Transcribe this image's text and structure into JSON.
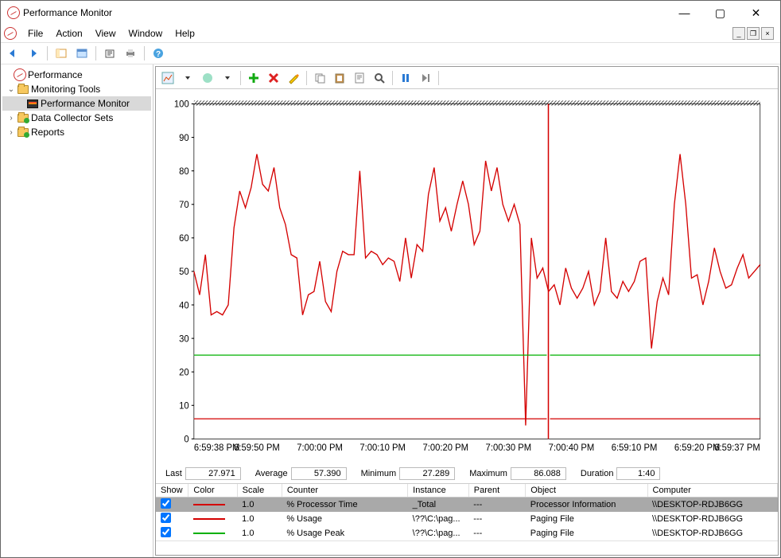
{
  "title": "Performance Monitor",
  "menus": [
    "File",
    "Action",
    "View",
    "Window",
    "Help"
  ],
  "tree": {
    "root": "Performance",
    "monitoring": "Monitoring Tools",
    "perfmon": "Performance Monitor",
    "dcs": "Data Collector Sets",
    "reports": "Reports"
  },
  "stats": {
    "last_label": "Last",
    "last": "27.971",
    "avg_label": "Average",
    "avg": "57.390",
    "min_label": "Minimum",
    "min": "27.289",
    "max_label": "Maximum",
    "max": "86.088",
    "dur_label": "Duration",
    "dur": "1:40"
  },
  "table": {
    "headers": [
      "Show",
      "Color",
      "Scale",
      "Counter",
      "Instance",
      "Parent",
      "Object",
      "Computer"
    ],
    "rows": [
      {
        "checked": true,
        "color": "#d40000",
        "scale": "1.0",
        "counter": "% Processor Time",
        "instance": "_Total",
        "parent": "---",
        "object": "Processor Information",
        "computer": "\\\\DESKTOP-RDJB6GG",
        "sel": true
      },
      {
        "checked": true,
        "color": "#d40000",
        "scale": "1.0",
        "counter": "% Usage",
        "instance": "\\??\\C:\\pag...",
        "parent": "---",
        "object": "Paging File",
        "computer": "\\\\DESKTOP-RDJB6GG"
      },
      {
        "checked": true,
        "color": "#00b000",
        "scale": "1.0",
        "counter": "% Usage Peak",
        "instance": "\\??\\C:\\pag...",
        "parent": "---",
        "object": "Paging File",
        "computer": "\\\\DESKTOP-RDJB6GG"
      }
    ]
  },
  "chart_data": {
    "type": "line",
    "ylabel": "",
    "xlabel": "",
    "ylim": [
      0,
      100
    ],
    "yticks": [
      0,
      10,
      20,
      30,
      40,
      50,
      60,
      70,
      80,
      90,
      100
    ],
    "xticks": [
      "6:59:38 PM",
      "6:59:50 PM",
      "7:00:00 PM",
      "7:00:10 PM",
      "7:00:20 PM",
      "7:00:30 PM",
      "7:00:40 PM",
      "6:59:10 PM",
      "6:59:20 PM",
      "6:59:37 PM"
    ],
    "wrap_x": 0.626,
    "series": [
      {
        "name": "% Processor Time",
        "color": "#d40000",
        "values": [
          50,
          43,
          55,
          37,
          38,
          37,
          40,
          63,
          74,
          69,
          75,
          85,
          76,
          74,
          81,
          69,
          64,
          55,
          54,
          37,
          43,
          44,
          53,
          41,
          38,
          50,
          56,
          55,
          55,
          80,
          54,
          56,
          55,
          52,
          54,
          53,
          47,
          60,
          48,
          58,
          56,
          73,
          81,
          65,
          69,
          62,
          70,
          77,
          70,
          58,
          62,
          83,
          74,
          81,
          70,
          65,
          70,
          64,
          4,
          60,
          48,
          51,
          44,
          46,
          40,
          51,
          45,
          42,
          45,
          50,
          40,
          44,
          60,
          44,
          42,
          47,
          44,
          47,
          53,
          54,
          27,
          41,
          48,
          43,
          70,
          85,
          70,
          48,
          49,
          40,
          47,
          57,
          50,
          45,
          46,
          51,
          55,
          48,
          50,
          52
        ]
      },
      {
        "name": "% Usage",
        "color": "#d40000",
        "values_const": 6
      },
      {
        "name": "% Usage Peak",
        "color": "#00b000",
        "values_const": 25
      }
    ]
  }
}
